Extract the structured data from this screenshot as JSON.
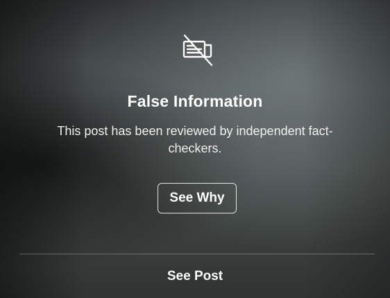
{
  "overlay": {
    "icon": "news-crossed-out-icon",
    "title": "False Information",
    "description": "This post has been reviewed by independent fact-checkers.",
    "see_why_label": "See Why",
    "see_post_label": "See Post"
  }
}
